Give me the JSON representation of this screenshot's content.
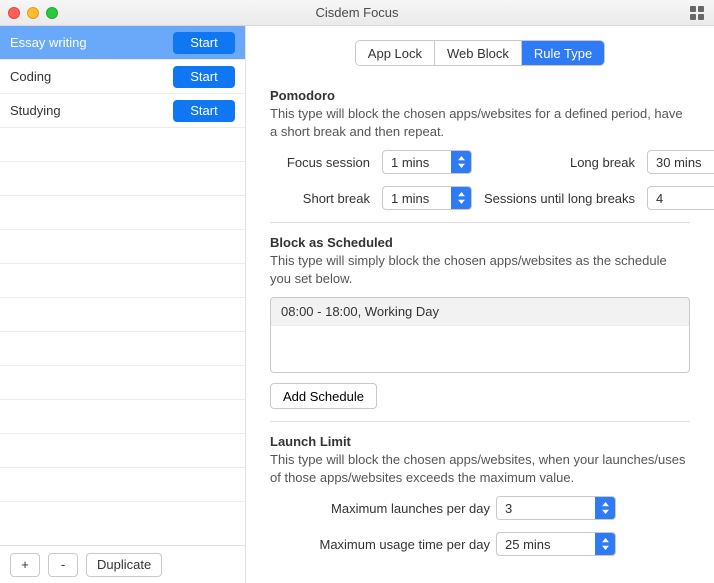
{
  "window": {
    "title": "Cisdem Focus"
  },
  "sidebar": {
    "items": [
      {
        "label": "Essay writing",
        "button": "Start",
        "selected": true
      },
      {
        "label": "Coding",
        "button": "Start",
        "selected": false
      },
      {
        "label": "Studying",
        "button": "Start",
        "selected": false
      }
    ],
    "footer": {
      "add": "+",
      "remove": "-",
      "duplicate": "Duplicate"
    }
  },
  "tabs": {
    "app_lock": "App Lock",
    "web_block": "Web Block",
    "rule_type": "Rule Type",
    "active": "rule_type"
  },
  "pomodoro": {
    "heading": "Pomodoro",
    "desc": "This type will block the chosen apps/websites for a defined period, have a short break and then repeat.",
    "focus_label": "Focus session",
    "focus_value": "1 mins",
    "long_label": "Long break",
    "long_value": "30 mins",
    "short_label": "Short break",
    "short_value": "1 mins",
    "until_label": "Sessions until long breaks",
    "until_value": "4"
  },
  "scheduled": {
    "heading": "Block as Scheduled",
    "desc": "This type will simply block the chosen apps/websites as the schedule you set below.",
    "items": [
      "08:00 - 18:00, Working Day"
    ],
    "add": "Add Schedule"
  },
  "launch": {
    "heading": "Launch Limit",
    "desc": "This type will block the chosen apps/websites, when your launches/uses of those apps/websites exceeds the maximum value.",
    "max_launches_label": "Maximum launches per day",
    "max_launches_value": "3",
    "max_usage_label": "Maximum usage time per day",
    "max_usage_value": "25 mins"
  }
}
